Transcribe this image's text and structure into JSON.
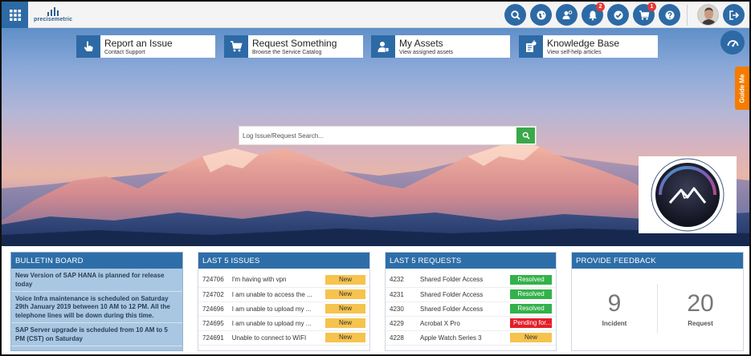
{
  "app": {
    "logo_text": "precisemetric"
  },
  "header": {
    "icons": [
      "search-icon",
      "globe-icon",
      "user-settings-icon",
      "bell-icon",
      "approval-icon",
      "cart-icon",
      "help-icon",
      "logout-icon"
    ],
    "notifications_badge": "2",
    "cart_badge": "1"
  },
  "quick_links": [
    {
      "title": "Report an Issue",
      "subtitle": "Contact Support",
      "icon": "hand-pointer-icon"
    },
    {
      "title": "Request Something",
      "subtitle": "Browse the Service Catalog",
      "icon": "cart-icon"
    },
    {
      "title": "My Assets",
      "subtitle": "View assigned assets",
      "icon": "user-asset-icon"
    },
    {
      "title": "Knowledge Base",
      "subtitle": "View self-help articles",
      "icon": "knowledge-icon"
    }
  ],
  "guide_me": "Guide Me",
  "search": {
    "placeholder": "Log Issue/Request Search..."
  },
  "bulletin": {
    "title": "BULLETIN BOARD",
    "items": [
      "New Version of SAP HANA is planned for release today",
      "Voice Infra maintenance is scheduled on Saturday 29th January 2019 between 10 AM to 12 PM. All the telephone lines will be down during this time.",
      "SAP Server upgrade is scheduled from 10 AM to 5 PM (CST) on Saturday"
    ]
  },
  "issues": {
    "title": "LAST 5 ISSUES",
    "rows": [
      {
        "id": "724706",
        "text": "I'm having with vpn",
        "status": "New"
      },
      {
        "id": "724702",
        "text": "I am unable to access the ...",
        "status": "New"
      },
      {
        "id": "724696",
        "text": "I am unable to upload my ...",
        "status": "New"
      },
      {
        "id": "724695",
        "text": "I am unable to upload my ...",
        "status": "New"
      },
      {
        "id": "724691",
        "text": "Unable to connect to WIFI",
        "status": "New"
      }
    ]
  },
  "requests": {
    "title": "LAST 5 REQUESTS",
    "rows": [
      {
        "id": "4232",
        "text": "Shared Folder Access",
        "status": "Resolved"
      },
      {
        "id": "4231",
        "text": "Shared Folder Access",
        "status": "Resolved"
      },
      {
        "id": "4230",
        "text": "Shared Folder Access",
        "status": "Resolved"
      },
      {
        "id": "4229",
        "text": "Acrobat X Pro",
        "status": "Pending for..."
      },
      {
        "id": "4228",
        "text": "Apple Watch Series 3",
        "status": "New"
      }
    ]
  },
  "feedback": {
    "title": "PROVIDE FEEDBACK",
    "incident_count": "9",
    "incident_label": "Incident",
    "request_count": "20",
    "request_label": "Request"
  },
  "colors": {
    "primary": "#2e6ea8",
    "new": "#f6c34e",
    "resolved": "#33b14a",
    "pending": "#e41e2a",
    "guide": "#f57c00"
  }
}
